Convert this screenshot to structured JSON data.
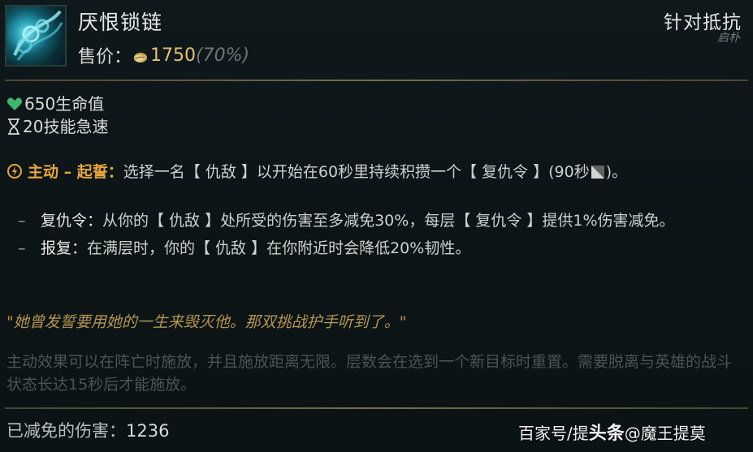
{
  "item": {
    "name": "厌恨锁链",
    "price_label": "售价：",
    "price_value": "1750",
    "price_pct": "(70%)",
    "category": "针对抵抗",
    "corner_mark": "启朴"
  },
  "stats": [
    {
      "icon": "heart-icon",
      "text": "650生命值",
      "color": "#3fb56d"
    },
    {
      "icon": "hourglass-icon",
      "text": "20技能急速",
      "color": "#d8dcd8"
    }
  ],
  "active": {
    "tag": "主动 – 起誓：",
    "text": "选择一名【 仇敌 】以开始在60秒里持续积攒一个【 复仇令 】(90秒",
    "tail": ")。"
  },
  "sub_items": [
    {
      "name": "复仇令：",
      "text": "从你的【 仇敌 】处所受的伤害至多减免30%，每层【 复仇令 】提供1%伤害减免。"
    },
    {
      "name": "报复：",
      "text": "在满层时，你的【 仇敌 】在你附近时会降低20%韧性。"
    }
  ],
  "lore": "\"她曾发誓要用她的一生来毁灭他。那双挑战护手听到了。\"",
  "note": "主动效果可以在阵亡时施放，并且施放距离无限。层数会在选到一个新目标时重置。需要脱离与英雄的战斗状态长达15秒后才能施放。",
  "mitigated": {
    "label": "已减免的伤害：",
    "value": "1236"
  },
  "watermark": {
    "part1": "百家号/",
    "part2": "提",
    "part3": "头条",
    "part4": "@魔王提莫"
  },
  "colors": {
    "gold": "#e5c16f",
    "active_orange": "#e6a63d",
    "lore_gold": "#b49650",
    "divider": "#7a6d47"
  }
}
